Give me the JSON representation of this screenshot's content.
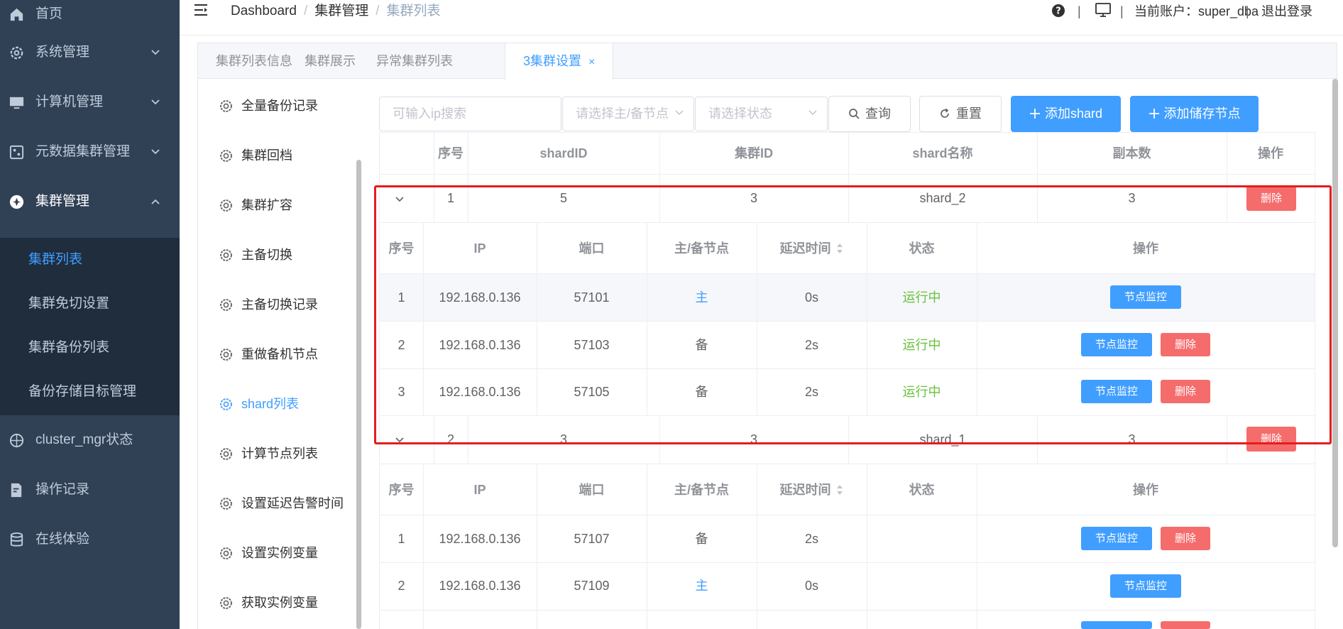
{
  "sidebar": {
    "items": [
      {
        "label": "首页",
        "icon": "home-icon"
      },
      {
        "label": "系统管理",
        "icon": "gear-icon"
      },
      {
        "label": "计算机管理",
        "icon": "monitor-icon"
      },
      {
        "label": "元数据集群管理",
        "icon": "dashboard-icon"
      },
      {
        "label": "集群管理",
        "icon": "cluster-icon"
      },
      {
        "label": "cluster_mgr状态",
        "icon": "globe-icon"
      },
      {
        "label": "操作记录",
        "icon": "edit-doc-icon"
      },
      {
        "label": "在线体验",
        "icon": "database-icon"
      }
    ],
    "sub_items": [
      "集群列表",
      "集群免切设置",
      "集群备份列表",
      "备份存储目标管理"
    ]
  },
  "header": {
    "breadcrumb": [
      "Dashboard",
      "集群管理",
      "集群列表"
    ],
    "separator": "/",
    "account": "当前账户：super_dba",
    "logout": "退出登录",
    "divider": "|"
  },
  "tabs": [
    "集群列表信息",
    "集群展示",
    "异常集群列表",
    "3集群设置"
  ],
  "tab_close": "×",
  "left_menu": [
    "全量备份记录",
    "集群回档",
    "集群扩容",
    "主备切换",
    "主备切换记录",
    "重做备机节点",
    "shard列表",
    "计算节点列表",
    "设置延迟告警时间",
    "设置实例变量",
    "获取实例变量"
  ],
  "filters": {
    "ip_placeholder": "可输入ip搜索",
    "node_placeholder": "请选择主/备节点",
    "status_placeholder": "请选择状态",
    "query": "查询",
    "reset": "重置",
    "add_shard": "添加shard",
    "add_storage": "添加储存节点"
  },
  "table": {
    "headers": [
      "序号",
      "shardID",
      "集群ID",
      "shard名称",
      "副本数",
      "操作"
    ],
    "rows": [
      {
        "no": "1",
        "shard_id": "5",
        "cluster_id": "3",
        "name": "shard_2",
        "replicas": "3",
        "action": "删除"
      },
      {
        "no": "2",
        "shard_id": "3",
        "cluster_id": "3",
        "name": "shard_1",
        "replicas": "3",
        "action": "删除"
      }
    ]
  },
  "inner_table": {
    "headers": [
      "序号",
      "IP",
      "端口",
      "主/备节点",
      "延迟时间",
      "状态",
      "操作"
    ],
    "monitor": "节点监控",
    "delete": "删除",
    "groups": [
      [
        {
          "no": "1",
          "ip": "192.168.0.136",
          "port": "57101",
          "role": "主",
          "delay": "0s",
          "status": "运行中"
        },
        {
          "no": "2",
          "ip": "192.168.0.136",
          "port": "57103",
          "role": "备",
          "delay": "2s",
          "status": "运行中"
        },
        {
          "no": "3",
          "ip": "192.168.0.136",
          "port": "57105",
          "role": "备",
          "delay": "2s",
          "status": "运行中"
        }
      ],
      [
        {
          "no": "1",
          "ip": "192.168.0.136",
          "port": "57107",
          "role": "备",
          "delay": "2s",
          "status": ""
        },
        {
          "no": "2",
          "ip": "192.168.0.136",
          "port": "57109",
          "role": "主",
          "delay": "0s",
          "status": ""
        }
      ]
    ]
  },
  "colors": {
    "sidebar": "#304156",
    "submenu": "#1f2d3d",
    "primary": "#409eff",
    "danger": "#f56c6c",
    "success": "#67c23a",
    "highlight": "#e61c1c"
  }
}
